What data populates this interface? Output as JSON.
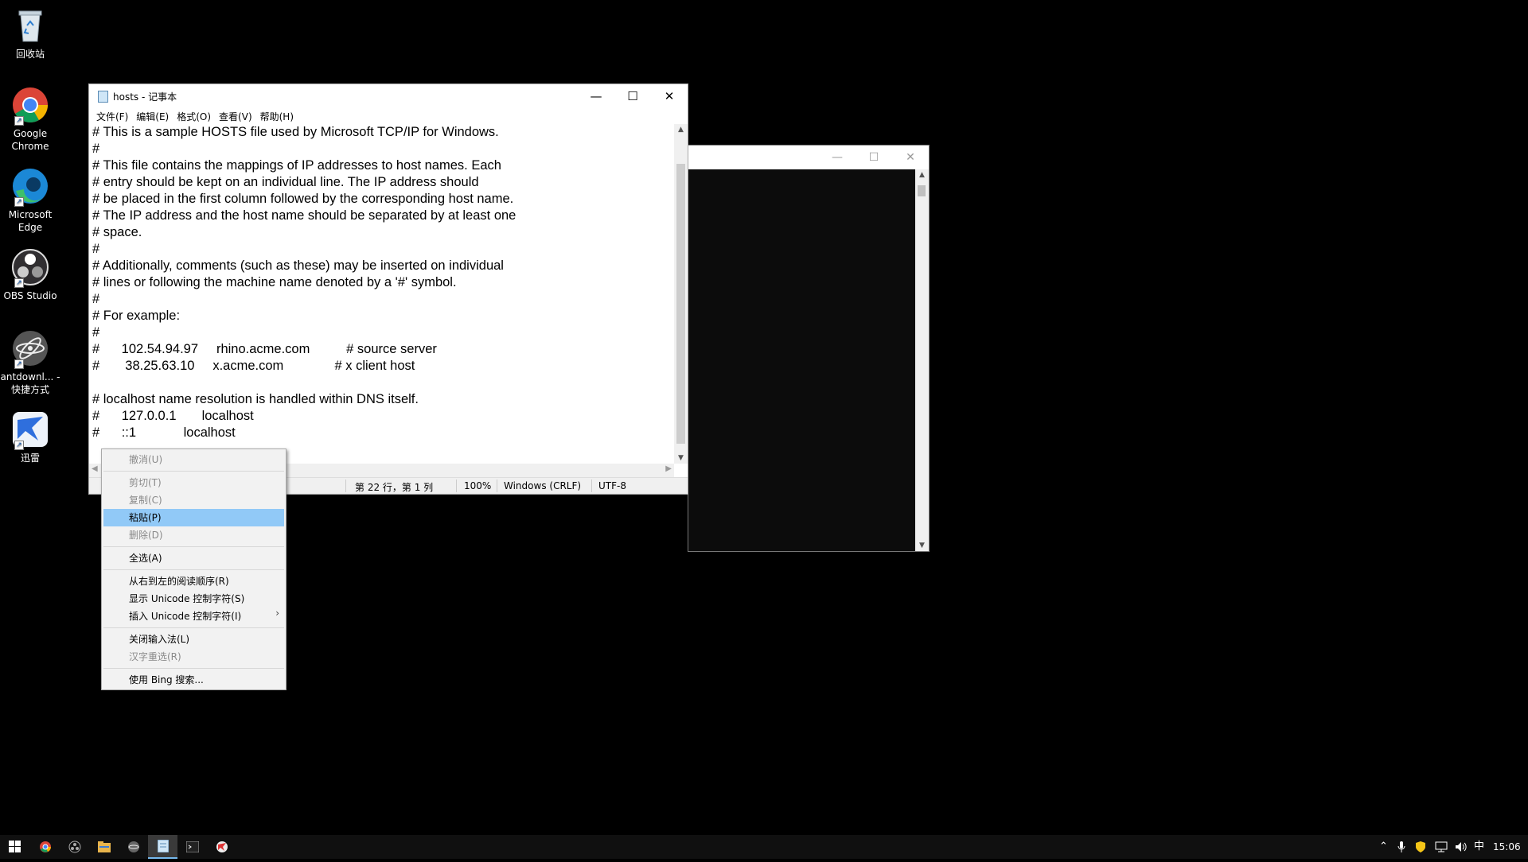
{
  "desktop": {
    "icons": [
      {
        "label": "回收站",
        "icon": "recycle-bin-icon"
      },
      {
        "label": "Google Chrome",
        "icon": "chrome-icon"
      },
      {
        "label": "Microsoft Edge",
        "icon": "edge-icon"
      },
      {
        "label": "OBS Studio",
        "icon": "obs-icon"
      },
      {
        "label": "antdownl... - 快捷方式",
        "icon": "antdownload-icon"
      },
      {
        "label": "迅雷",
        "icon": "xunlei-icon"
      }
    ]
  },
  "notepad": {
    "title": "hosts - 记事本",
    "menu": [
      "文件(F)",
      "编辑(E)",
      "格式(O)",
      "查看(V)",
      "帮助(H)"
    ],
    "content": "# This is a sample HOSTS file used by Microsoft TCP/IP for Windows.\n#\n# This file contains the mappings of IP addresses to host names. Each\n# entry should be kept on an individual line. The IP address should\n# be placed in the first column followed by the corresponding host name.\n# The IP address and the host name should be separated by at least one\n# space.\n#\n# Additionally, comments (such as these) may be inserted on individual\n# lines or following the machine name denoted by a '#' symbol.\n#\n# For example:\n#\n#      102.54.94.97     rhino.acme.com          # source server\n#       38.25.63.10     x.acme.com              # x client host\n\n# localhost name resolution is handled within DNS itself.\n#\t127.0.0.1       localhost\n#\t::1             localhost\n",
    "status": {
      "position": "第 22 行，第 1 列",
      "zoom": "100%",
      "line_ending": "Windows (CRLF)",
      "encoding": "UTF-8"
    }
  },
  "context_menu": {
    "items": [
      {
        "label": "撤消(U)",
        "disabled": true
      },
      {
        "sep": true
      },
      {
        "label": "剪切(T)",
        "disabled": true
      },
      {
        "label": "复制(C)",
        "disabled": true
      },
      {
        "label": "粘贴(P)",
        "selected": true
      },
      {
        "label": "删除(D)",
        "disabled": true
      },
      {
        "sep": true
      },
      {
        "label": "全选(A)"
      },
      {
        "sep": true
      },
      {
        "label": "从右到左的阅读顺序(R)"
      },
      {
        "label": "显示 Unicode 控制字符(S)"
      },
      {
        "label": "插入 Unicode 控制字符(I)",
        "submenu": true
      },
      {
        "sep": true
      },
      {
        "label": "关闭输入法(L)"
      },
      {
        "label": "汉字重选(R)",
        "disabled": true
      },
      {
        "sep": true
      },
      {
        "label": "使用 Bing 搜索..."
      }
    ]
  },
  "taskbar": {
    "ime": "中",
    "time": "15:06"
  }
}
